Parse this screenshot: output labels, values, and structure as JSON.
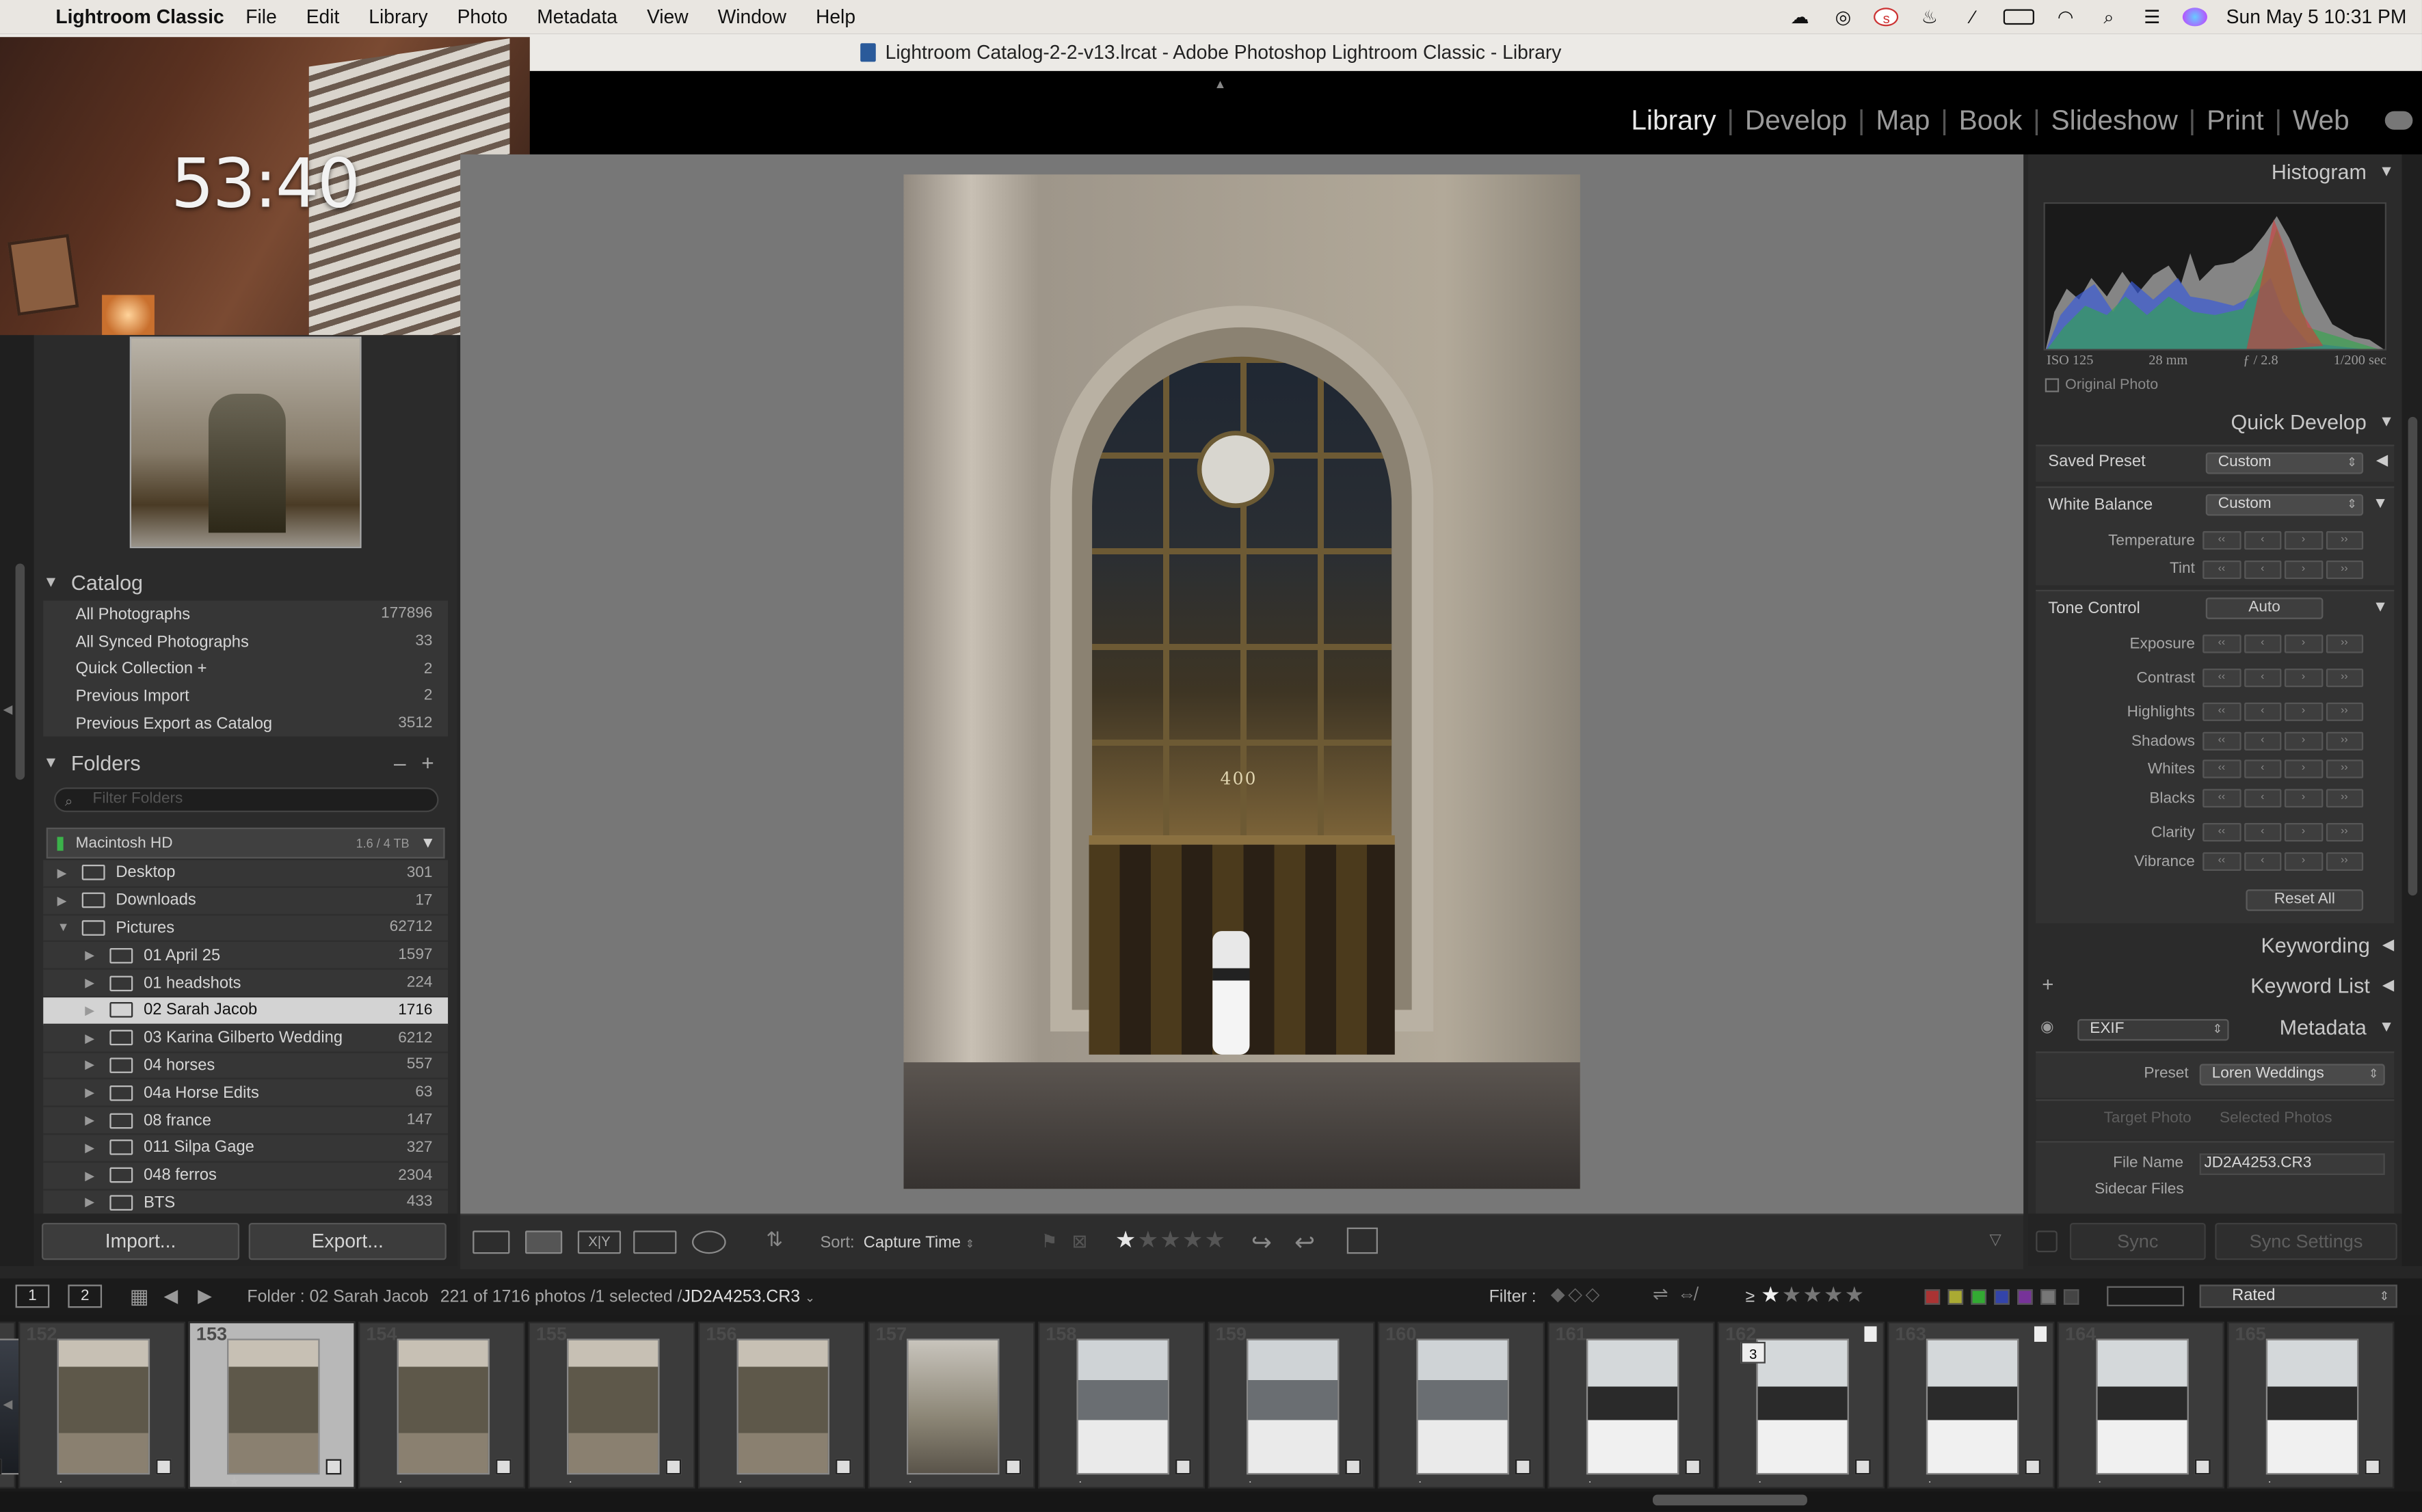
{
  "menubar": {
    "app": "Lightroom Classic",
    "items": [
      "File",
      "Edit",
      "Library",
      "Photo",
      "Metadata",
      "View",
      "Window",
      "Help"
    ],
    "clock": "Sun May 5  10:31 PM",
    "status_icons": [
      "creative-cloud-icon",
      "airdrop-icon",
      "s-app-icon",
      "flame-icon",
      "mute-icon",
      "battery-icon",
      "wifi-icon",
      "search-icon",
      "control-center-icon",
      "siri-icon"
    ]
  },
  "titlebar": {
    "title": "Lightroom Catalog-2-2-v13.lrcat - Adobe Photoshop Lightroom Classic - Library"
  },
  "modules": [
    "Library",
    "Develop",
    "Map",
    "Book",
    "Slideshow",
    "Print",
    "Web"
  ],
  "active_module": "Library",
  "timer": {
    "time": "53:40"
  },
  "catalog": {
    "title": "Catalog",
    "items": [
      {
        "label": "All Photographs",
        "count": "177896"
      },
      {
        "label": "All Synced Photographs",
        "count": "33"
      },
      {
        "label": "Quick Collection  +",
        "count": "2"
      },
      {
        "label": "Previous Import",
        "count": "2"
      },
      {
        "label": "Previous Export as Catalog",
        "count": "3512"
      }
    ]
  },
  "folders": {
    "title": "Folders",
    "filter_placeholder": "Filter Folders",
    "volume": {
      "name": "Macintosh HD",
      "size": "1.6 / 4 TB"
    },
    "items": [
      {
        "label": "Desktop",
        "count": "301",
        "level": 0,
        "expanded": false
      },
      {
        "label": "Downloads",
        "count": "17",
        "level": 0,
        "expanded": false
      },
      {
        "label": "Pictures",
        "count": "62712",
        "level": 0,
        "expanded": true
      },
      {
        "label": "01 April 25",
        "count": "1597",
        "level": 1,
        "expanded": false
      },
      {
        "label": "01 headshots",
        "count": "224",
        "level": 1,
        "expanded": false
      },
      {
        "label": "02 Sarah Jacob",
        "count": "1716",
        "level": 1,
        "expanded": false,
        "selected": true
      },
      {
        "label": "03 Karina Gilberto Wedding",
        "count": "6212",
        "level": 1,
        "expanded": false
      },
      {
        "label": "04 horses",
        "count": "557",
        "level": 1,
        "expanded": false
      },
      {
        "label": "04a Horse Edits",
        "count": "63",
        "level": 1,
        "expanded": false
      },
      {
        "label": "08 france",
        "count": "147",
        "level": 1,
        "expanded": false
      },
      {
        "label": "011 Silpa Gage",
        "count": "327",
        "level": 1,
        "expanded": false
      },
      {
        "label": "048 ferros",
        "count": "2304",
        "level": 1,
        "expanded": false
      },
      {
        "label": "BTS",
        "count": "433",
        "level": 1,
        "expanded": false
      }
    ]
  },
  "left_buttons": {
    "import": "Import...",
    "export": "Export..."
  },
  "photo": {
    "building_number": "400"
  },
  "toolbar": {
    "sort_label": "Sort:",
    "sort_value": "Capture Time",
    "rating": 1
  },
  "histogram": {
    "title": "Histogram",
    "iso": "ISO 125",
    "focal": "28 mm",
    "aperture": "ƒ / 2.8",
    "shutter": "1/200 sec",
    "original_photo": "Original Photo"
  },
  "quick_develop": {
    "title": "Quick Develop",
    "saved_preset_label": "Saved Preset",
    "saved_preset_value": "Custom",
    "white_balance_label": "White Balance",
    "white_balance_value": "Custom",
    "temperature": "Temperature",
    "tint": "Tint",
    "tone_control": "Tone Control",
    "auto": "Auto",
    "exposure": "Exposure",
    "contrast": "Contrast",
    "highlights": "Highlights",
    "shadows": "Shadows",
    "whites": "Whites",
    "blacks": "Blacks",
    "clarity": "Clarity",
    "vibrance": "Vibrance",
    "reset_all": "Reset All"
  },
  "keywording": {
    "title": "Keywording"
  },
  "keyword_list": {
    "title": "Keyword List"
  },
  "metadata": {
    "title": "Metadata",
    "set": "EXIF",
    "preset_label": "Preset",
    "preset_value": "Loren Weddings",
    "target_photo": "Target Photo",
    "selected_photos": "Selected Photos",
    "file_name_label": "File Name",
    "file_name_value": "JD2A4253.CR3",
    "sidecar_label": "Sidecar Files"
  },
  "sync": {
    "sync": "Sync",
    "sync_settings": "Sync Settings"
  },
  "filmstrip_header": {
    "page1": "1",
    "page2": "2",
    "folder": "Folder : 02 Sarah Jacob",
    "count_prefix": "221 of 1716 photos /1 selected /",
    "count_file": "JD2A4253.CR3",
    "filter_label": "Filter :",
    "rating_op": "≥",
    "filter_rating": 1,
    "rated": "Rated"
  },
  "filmstrip": [
    {
      "num": "",
      "kind": "dark"
    },
    {
      "num": "152",
      "kind": "door"
    },
    {
      "num": "153",
      "kind": "door",
      "selected": true
    },
    {
      "num": "154",
      "kind": "door"
    },
    {
      "num": "155",
      "kind": "door"
    },
    {
      "num": "156",
      "kind": "door"
    },
    {
      "num": "157",
      "kind": "street"
    },
    {
      "num": "158",
      "kind": "city"
    },
    {
      "num": "159",
      "kind": "city"
    },
    {
      "num": "160",
      "kind": "city"
    },
    {
      "num": "161",
      "kind": "couple"
    },
    {
      "num": "162",
      "kind": "couple",
      "tag": "3",
      "flag": true
    },
    {
      "num": "163",
      "kind": "couple",
      "flag": true
    },
    {
      "num": "164",
      "kind": "couple"
    },
    {
      "num": "165",
      "kind": "couple"
    }
  ]
}
